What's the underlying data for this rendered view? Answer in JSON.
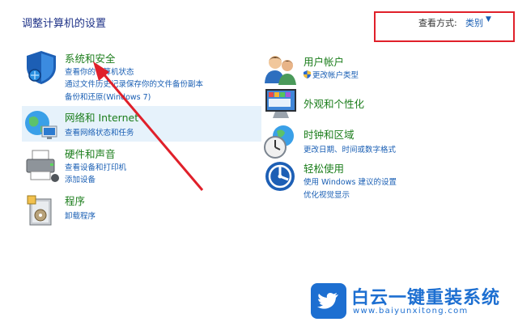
{
  "header": {
    "title": "调整计算机的设置",
    "view_by_label": "查看方式:",
    "view_by_value": "类别"
  },
  "left_categories": [
    {
      "label": "系统和安全",
      "links": [
        "查看你的计算机状态",
        "通过文件历史记录保存你的文件备份副本",
        "备份和还原(Windows 7)"
      ]
    },
    {
      "label": "网络和 Internet",
      "links": [
        "查看网络状态和任务"
      ]
    },
    {
      "label": "硬件和声音",
      "links": [
        "查看设备和打印机",
        "添加设备"
      ]
    },
    {
      "label": "程序",
      "links": [
        "卸载程序"
      ]
    }
  ],
  "right_categories": [
    {
      "label": "用户帐户",
      "links": [
        "更改帐户类型"
      ]
    },
    {
      "label": "外观和个性化",
      "links": []
    },
    {
      "label": "时钟和区域",
      "links": [
        "更改日期、时间或数字格式"
      ]
    },
    {
      "label": "轻松使用",
      "links": [
        "使用 Windows 建议的设置",
        "优化视觉显示"
      ]
    }
  ],
  "watermark": {
    "brand": "白云一键重装系统",
    "url": "www.baiyunxitong.com"
  },
  "colors": {
    "category_green": "#1b7d1b",
    "link_blue": "#1a5fb4",
    "title_blue": "#1e3287",
    "annotation_red": "#e0202a",
    "highlight_bg": "#e6f2fb"
  }
}
